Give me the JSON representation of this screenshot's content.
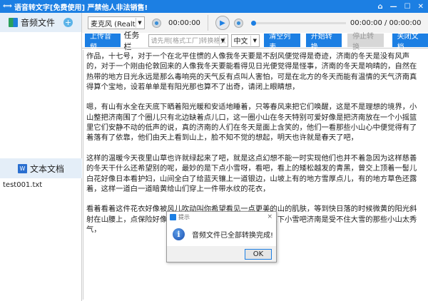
{
  "window": {
    "title": "语音转文字[免费使用] 严禁他人非法销售!",
    "controls": [
      "pin",
      "minimize",
      "maximize",
      "close"
    ]
  },
  "sidebar": {
    "audio_header": "音频文件",
    "text_header": "文本文档",
    "files": [
      "test001.txt"
    ]
  },
  "player": {
    "mic_select": "麦克风 (Realtek Audi",
    "record_time": "00:00:00",
    "play_time": "00:00:00 / 00:00:00",
    "progress": 0
  },
  "toolbar": {
    "upload": "上传音频",
    "task_label": "任务栏",
    "task_placeholder": "请先用[格式工厂]转换格式!",
    "language": "中文",
    "clear": "清空列表",
    "start": "开始转换",
    "stop": "停止转换",
    "close_doc": "关闭文档"
  },
  "content": {
    "paragraphs": [
      "作品，十七号，对于一个在北平住惯的人像我冬天要是不刮风便觉得是奇迹，济南的冬天是没有风声的，对于一个刚由伦敦回来的人像我冬天要能看得见日光便觉得是怪事，济南的冬天是响晴的，自然在热带的地方日光永远是那么毒响亮的天气反有点叫人害怕，可是在北方的冬天而能有温情的天气济南真得算个宝地，设若单单是有阳光那也算不了出奇，请闭上眼睛想，",
      "嗯，有山有水全在天底下晒着阳光暖和安适地睡着，只等春风来把它们唤醒，这是不是理想的境界，小山整把济南围了个圈儿只有北边缺着点儿口，这一圈小山在冬天特别可爱好像是把济南放在一个小摇篮里它们安静不动的低声的说，真的济南的人们在冬天是面上含笑的，他们一看那些小山心中便觉得有了着落有了依靠，他们由天上看到山上，脸不知不觉的想起，明天也许就是春天了吧，",
      "这样的温暖今天夜里山草也许就绿起来了吧，就是这点幻想不能一时实现他们也并不着急因为这样慈善的冬天干什么还希望别的呢，最妙的是下点小雪呀，看吧，看上的矮松越发的青黑，曾交上顶着一髻儿白花好像日本看护妇，山间全白了给蓝天镶上一道银边，山坡上有的地方雪厚点儿，有的地方草色还露着，这样一道白一道暗黄给山们穿上一件带水纹的花衣，",
      "看着看着这件花衣好像被风儿吹动叫你希望看见一点更美的山的肌肤，等到快日落的时候微黄的阳光斜射在山腰上，点保险好像忽然害羞微微露出点儿粉色，就是下小雪吧济南是受不住大雪的那些小山太秀气，"
    ]
  },
  "dialog": {
    "title": "提示",
    "message": "音频文件已全部转换完成!",
    "ok": "OK",
    "close": "×"
  }
}
